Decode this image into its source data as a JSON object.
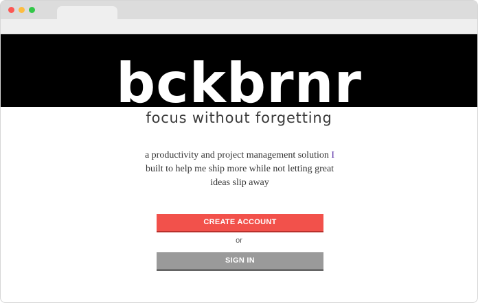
{
  "colors": {
    "close_dot": "#fc5753",
    "minimize_dot": "#fdbc40",
    "maximize_dot": "#33c748",
    "hero_background": "#000000",
    "create_button": "#f2514b",
    "signin_button": "#9a9a9a"
  },
  "hero": {
    "logo": "bckbrnr",
    "tagline": "focus without forgetting"
  },
  "intro": {
    "line1_before": "a productivity and project management solution",
    "line1_i": "I",
    "rest": "built to help me ship more while not letting great ideas slip away"
  },
  "actions": {
    "create_account_label": "CREATE ACCOUNT",
    "separator": "or",
    "sign_in_label": "SIGN IN"
  }
}
